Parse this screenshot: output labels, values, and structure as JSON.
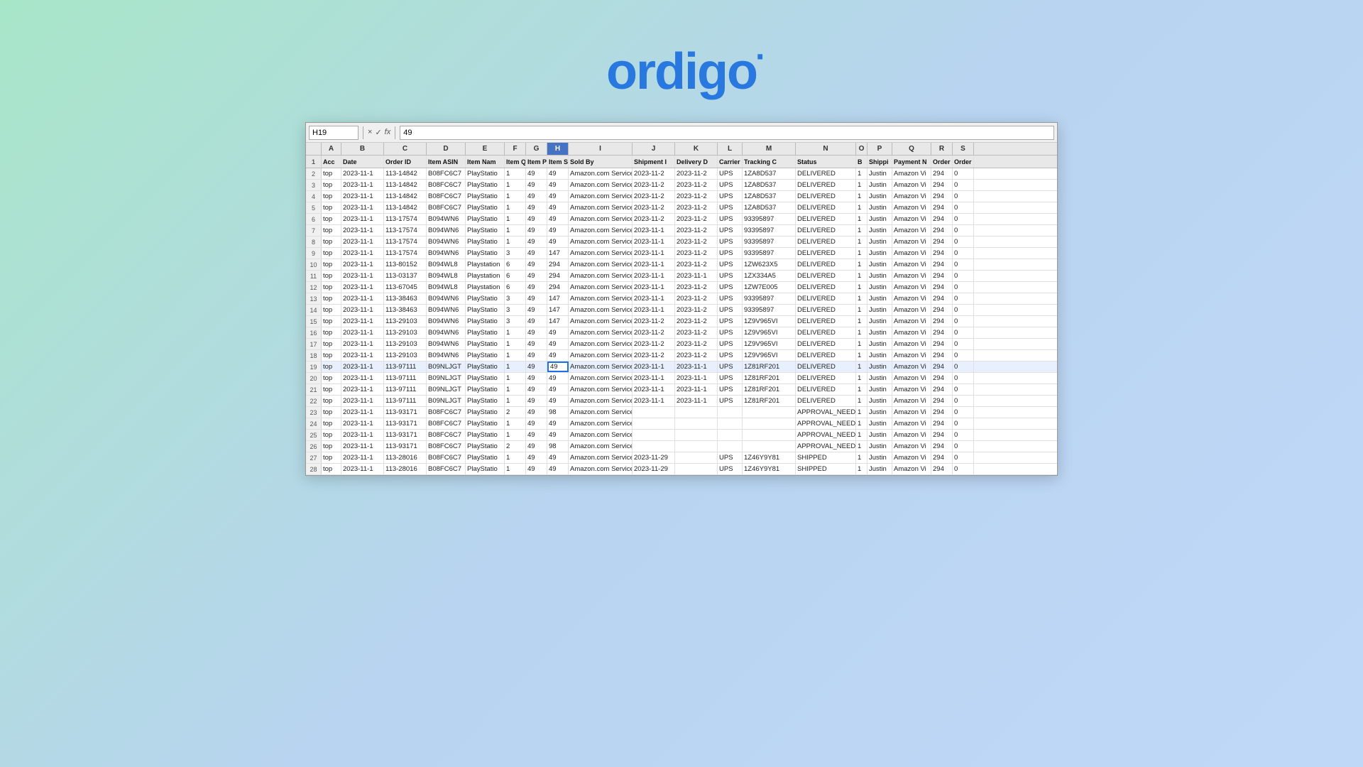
{
  "logo": {
    "text": "ordigo",
    "dot": "·"
  },
  "formula_bar": {
    "cell_ref": "H19",
    "formula_value": "49",
    "icons": [
      "×",
      "✓",
      "fx"
    ]
  },
  "columns": {
    "headers": [
      "A",
      "B",
      "C",
      "D",
      "E",
      "F",
      "G",
      "H",
      "I",
      "J",
      "K",
      "L",
      "M",
      "N",
      "O",
      "P",
      "Q",
      "R",
      "S"
    ]
  },
  "header_labels": {
    "A": "Acc",
    "B": "Date",
    "C": "Order ID",
    "D": "Item ASIN",
    "E": "Item Nam",
    "F": "Item Quan",
    "G": "Item Price",
    "H": "Item Subt",
    "I": "Sold By",
    "J": "Shipment I",
    "K": "Delivery D",
    "L": "Carrier",
    "M": "Tracking C",
    "N": "Status",
    "O": "B",
    "P": "Shippi",
    "Q": "Payment N",
    "R": "Order Subt",
    "S": "Order Ship"
  },
  "rows": [
    {
      "num": 2,
      "a": "top",
      "b": "2023-11-1",
      "c": "113-14842",
      "d": "B08FC6C7",
      "e": "PlayStatio",
      "f": "1",
      "g": "49",
      "h": "49",
      "i": "Amazon.com Services LLC",
      "j": "2023-11-2",
      "k": "2023-11-2",
      "l": "UPS",
      "m": "1ZA8D537",
      "n": "DELIVERED",
      "o": "1",
      "p": "Justin",
      "q": "Amazon Vi",
      "r": "294",
      "s": "0"
    },
    {
      "num": 3,
      "a": "top",
      "b": "2023-11-1",
      "c": "113-14842",
      "d": "B08FC6C7",
      "e": "PlayStatio",
      "f": "1",
      "g": "49",
      "h": "49",
      "i": "Amazon.com Services LLC",
      "j": "2023-11-2",
      "k": "2023-11-2",
      "l": "UPS",
      "m": "1ZA8D537",
      "n": "DELIVERED",
      "o": "1",
      "p": "Justin",
      "q": "Amazon Vi",
      "r": "294",
      "s": "0"
    },
    {
      "num": 4,
      "a": "top",
      "b": "2023-11-1",
      "c": "113-14842",
      "d": "B08FC6C7",
      "e": "PlayStatio",
      "f": "1",
      "g": "49",
      "h": "49",
      "i": "Amazon.com Services LLC",
      "j": "2023-11-2",
      "k": "2023-11-2",
      "l": "UPS",
      "m": "1ZA8D537",
      "n": "DELIVERED",
      "o": "1",
      "p": "Justin",
      "q": "Amazon Vi",
      "r": "294",
      "s": "0"
    },
    {
      "num": 5,
      "a": "top",
      "b": "2023-11-1",
      "c": "113-14842",
      "d": "B08FC6C7",
      "e": "PlayStatio",
      "f": "1",
      "g": "49",
      "h": "49",
      "i": "Amazon.com Services LLC",
      "j": "2023-11-2",
      "k": "2023-11-2",
      "l": "UPS",
      "m": "1ZA8D537",
      "n": "DELIVERED",
      "o": "1",
      "p": "Justin",
      "q": "Amazon Vi",
      "r": "294",
      "s": "0"
    },
    {
      "num": 6,
      "a": "top",
      "b": "2023-11-1",
      "c": "113-17574",
      "d": "B094WN6",
      "e": "PlayStatio",
      "f": "1",
      "g": "49",
      "h": "49",
      "i": "Amazon.com Services LLC",
      "j": "2023-11-2",
      "k": "2023-11-2",
      "l": "UPS",
      "m": "93395897",
      "n": "DELIVERED",
      "o": "1",
      "p": "Justin",
      "q": "Amazon Vi",
      "r": "294",
      "s": "0"
    },
    {
      "num": 7,
      "a": "top",
      "b": "2023-11-1",
      "c": "113-17574",
      "d": "B094WN6",
      "e": "PlayStatio",
      "f": "1",
      "g": "49",
      "h": "49",
      "i": "Amazon.com Services LLC",
      "j": "2023-11-1",
      "k": "2023-11-2",
      "l": "UPS",
      "m": "93395897",
      "n": "DELIVERED",
      "o": "1",
      "p": "Justin",
      "q": "Amazon Vi",
      "r": "294",
      "s": "0"
    },
    {
      "num": 8,
      "a": "top",
      "b": "2023-11-1",
      "c": "113-17574",
      "d": "B094WN6",
      "e": "PlayStatio",
      "f": "1",
      "g": "49",
      "h": "49",
      "i": "Amazon.com Services LLC",
      "j": "2023-11-1",
      "k": "2023-11-2",
      "l": "UPS",
      "m": "93395897",
      "n": "DELIVERED",
      "o": "1",
      "p": "Justin",
      "q": "Amazon Vi",
      "r": "294",
      "s": "0"
    },
    {
      "num": 9,
      "a": "top",
      "b": "2023-11-1",
      "c": "113-17574",
      "d": "B094WN6",
      "e": "PlayStatio",
      "f": "3",
      "g": "49",
      "h": "147",
      "i": "Amazon.com Services LLC",
      "j": "2023-11-1",
      "k": "2023-11-2",
      "l": "UPS",
      "m": "93395897",
      "n": "DELIVERED",
      "o": "1",
      "p": "Justin",
      "q": "Amazon Vi",
      "r": "294",
      "s": "0"
    },
    {
      "num": 10,
      "a": "top",
      "b": "2023-11-1",
      "c": "113-80152",
      "d": "B094WL8",
      "e": "Playstation",
      "f": "6",
      "g": "49",
      "h": "294",
      "i": "Amazon.com Services LLC",
      "j": "2023-11-1",
      "k": "2023-11-2",
      "l": "UPS",
      "m": "1ZW623X5",
      "n": "DELIVERED",
      "o": "1",
      "p": "Justin",
      "q": "Amazon Vi",
      "r": "294",
      "s": "0"
    },
    {
      "num": 11,
      "a": "top",
      "b": "2023-11-1",
      "c": "113-03137",
      "d": "B094WL8",
      "e": "Playstation",
      "f": "6",
      "g": "49",
      "h": "294",
      "i": "Amazon.com Services LLC",
      "j": "2023-11-1",
      "k": "2023-11-1",
      "l": "UPS",
      "m": "1ZX334A5",
      "n": "DELIVERED",
      "o": "1",
      "p": "Justin",
      "q": "Amazon Vi",
      "r": "294",
      "s": "0"
    },
    {
      "num": 12,
      "a": "top",
      "b": "2023-11-1",
      "c": "113-67045",
      "d": "B094WL8",
      "e": "Playstation",
      "f": "6",
      "g": "49",
      "h": "294",
      "i": "Amazon.com Services LLC",
      "j": "2023-11-1",
      "k": "2023-11-2",
      "l": "UPS",
      "m": "1ZW7E005",
      "n": "DELIVERED",
      "o": "1",
      "p": "Justin",
      "q": "Amazon Vi",
      "r": "294",
      "s": "0"
    },
    {
      "num": 13,
      "a": "top",
      "b": "2023-11-1",
      "c": "113-38463",
      "d": "B094WN6",
      "e": "PlayStatio",
      "f": "3",
      "g": "49",
      "h": "147",
      "i": "Amazon.com Services LLC",
      "j": "2023-11-1",
      "k": "2023-11-2",
      "l": "UPS",
      "m": "93395897",
      "n": "DELIVERED",
      "o": "1",
      "p": "Justin",
      "q": "Amazon Vi",
      "r": "294",
      "s": "0"
    },
    {
      "num": 14,
      "a": "top",
      "b": "2023-11-1",
      "c": "113-38463",
      "d": "B094WN6",
      "e": "PlayStatio",
      "f": "3",
      "g": "49",
      "h": "147",
      "i": "Amazon.com Services LLC",
      "j": "2023-11-1",
      "k": "2023-11-2",
      "l": "UPS",
      "m": "93395897",
      "n": "DELIVERED",
      "o": "1",
      "p": "Justin",
      "q": "Amazon Vi",
      "r": "294",
      "s": "0"
    },
    {
      "num": 15,
      "a": "top",
      "b": "2023-11-1",
      "c": "113-29103",
      "d": "B094WN6",
      "e": "PlayStatio",
      "f": "3",
      "g": "49",
      "h": "147",
      "i": "Amazon.com Services LLC",
      "j": "2023-11-2",
      "k": "2023-11-2",
      "l": "UPS",
      "m": "1Z9V965VI",
      "n": "DELIVERED",
      "o": "1",
      "p": "Justin",
      "q": "Amazon Vi",
      "r": "294",
      "s": "0"
    },
    {
      "num": 16,
      "a": "top",
      "b": "2023-11-1",
      "c": "113-29103",
      "d": "B094WN6",
      "e": "PlayStatio",
      "f": "1",
      "g": "49",
      "h": "49",
      "i": "Amazon.com Services LLC",
      "j": "2023-11-2",
      "k": "2023-11-2",
      "l": "UPS",
      "m": "1Z9V965VI",
      "n": "DELIVERED",
      "o": "1",
      "p": "Justin",
      "q": "Amazon Vi",
      "r": "294",
      "s": "0"
    },
    {
      "num": 17,
      "a": "top",
      "b": "2023-11-1",
      "c": "113-29103",
      "d": "B094WN6",
      "e": "PlayStatio",
      "f": "1",
      "g": "49",
      "h": "49",
      "i": "Amazon.com Services LLC",
      "j": "2023-11-2",
      "k": "2023-11-2",
      "l": "UPS",
      "m": "1Z9V965VI",
      "n": "DELIVERED",
      "o": "1",
      "p": "Justin",
      "q": "Amazon Vi",
      "r": "294",
      "s": "0"
    },
    {
      "num": 18,
      "a": "top",
      "b": "2023-11-1",
      "c": "113-29103",
      "d": "B094WN6",
      "e": "PlayStatio",
      "f": "1",
      "g": "49",
      "h": "49",
      "i": "Amazon.com Services LLC",
      "j": "2023-11-2",
      "k": "2023-11-2",
      "l": "UPS",
      "m": "1Z9V965VI",
      "n": "DELIVERED",
      "o": "1",
      "p": "Justin",
      "q": "Amazon Vi",
      "r": "294",
      "s": "0"
    },
    {
      "num": 19,
      "a": "top",
      "b": "2023-11-1",
      "c": "113-97111",
      "d": "B09NLJGT",
      "e": "PlayStatio",
      "f": "1",
      "g": "49",
      "h": "49",
      "i": "Amazon.com Services LLC",
      "j": "2023-11-1",
      "k": "2023-11-1",
      "l": "UPS",
      "m": "1Z81RF201",
      "n": "DELIVERED",
      "o": "1",
      "p": "Justin",
      "q": "Amazon Vi",
      "r": "294",
      "s": "0",
      "selected": true
    },
    {
      "num": 20,
      "a": "top",
      "b": "2023-11-1",
      "c": "113-97111",
      "d": "B09NLJGT",
      "e": "PlayStatio",
      "f": "1",
      "g": "49",
      "h": "49",
      "i": "Amazon.com Services LLC",
      "j": "2023-11-1",
      "k": "2023-11-1",
      "l": "UPS",
      "m": "1Z81RF201",
      "n": "DELIVERED",
      "o": "1",
      "p": "Justin",
      "q": "Amazon Vi",
      "r": "294",
      "s": "0"
    },
    {
      "num": 21,
      "a": "top",
      "b": "2023-11-1",
      "c": "113-97111",
      "d": "B09NLJGT",
      "e": "PlayStatio",
      "f": "1",
      "g": "49",
      "h": "49",
      "i": "Amazon.com Services LLC",
      "j": "2023-11-1",
      "k": "2023-11-1",
      "l": "UPS",
      "m": "1Z81RF201",
      "n": "DELIVERED",
      "o": "1",
      "p": "Justin",
      "q": "Amazon Vi",
      "r": "294",
      "s": "0"
    },
    {
      "num": 22,
      "a": "top",
      "b": "2023-11-1",
      "c": "113-97111",
      "d": "B09NLJGT",
      "e": "PlayStatio",
      "f": "1",
      "g": "49",
      "h": "49",
      "i": "Amazon.com Services LLC",
      "j": "2023-11-1",
      "k": "2023-11-1",
      "l": "UPS",
      "m": "1Z81RF201",
      "n": "DELIVERED",
      "o": "1",
      "p": "Justin",
      "q": "Amazon Vi",
      "r": "294",
      "s": "0"
    },
    {
      "num": 23,
      "a": "top",
      "b": "2023-11-1",
      "c": "113-93171",
      "d": "B08FC6C7",
      "e": "PlayStatio",
      "f": "2",
      "g": "49",
      "h": "98",
      "i": "Amazon.com Services LLC",
      "j": "",
      "k": "",
      "l": "",
      "m": "",
      "n": "APPROVAL_NEEDED",
      "o": "1",
      "p": "Justin",
      "q": "Amazon Vi",
      "r": "294",
      "s": "0"
    },
    {
      "num": 24,
      "a": "top",
      "b": "2023-11-1",
      "c": "113-93171",
      "d": "B08FC6C7",
      "e": "PlayStatio",
      "f": "1",
      "g": "49",
      "h": "49",
      "i": "Amazon.com Services LLC",
      "j": "",
      "k": "",
      "l": "",
      "m": "",
      "n": "APPROVAL_NEEDED",
      "o": "1",
      "p": "Justin",
      "q": "Amazon Vi",
      "r": "294",
      "s": "0"
    },
    {
      "num": 25,
      "a": "top",
      "b": "2023-11-1",
      "c": "113-93171",
      "d": "B08FC6C7",
      "e": "PlayStatio",
      "f": "1",
      "g": "49",
      "h": "49",
      "i": "Amazon.com Services LLC",
      "j": "",
      "k": "",
      "l": "",
      "m": "",
      "n": "APPROVAL_NEEDED",
      "o": "1",
      "p": "Justin",
      "q": "Amazon Vi",
      "r": "294",
      "s": "0"
    },
    {
      "num": 26,
      "a": "top",
      "b": "2023-11-1",
      "c": "113-93171",
      "d": "B08FC6C7",
      "e": "PlayStatio",
      "f": "2",
      "g": "49",
      "h": "98",
      "i": "Amazon.com Services LLC",
      "j": "",
      "k": "",
      "l": "",
      "m": "",
      "n": "APPROVAL_NEEDED",
      "o": "1",
      "p": "Justin",
      "q": "Amazon Vi",
      "r": "294",
      "s": "0"
    },
    {
      "num": 27,
      "a": "top",
      "b": "2023-11-1",
      "c": "113-28016",
      "d": "B08FC6C7",
      "e": "PlayStatio",
      "f": "1",
      "g": "49",
      "h": "49",
      "i": "Amazon.com Services LLC",
      "j": "2023-11-29",
      "k": "",
      "l": "UPS",
      "m": "1Z46Y9Y81",
      "n": "SHIPPED",
      "o": "1",
      "p": "Justin",
      "q": "Amazon Vi",
      "r": "294",
      "s": "0"
    },
    {
      "num": 28,
      "a": "top",
      "b": "2023-11-1",
      "c": "113-28016",
      "d": "B08FC6C7",
      "e": "PlayStatio",
      "f": "1",
      "g": "49",
      "h": "49",
      "i": "Amazon.com Services LLC",
      "j": "2023-11-29",
      "k": "",
      "l": "UPS",
      "m": "1Z46Y9Y81",
      "n": "SHIPPED",
      "o": "1",
      "p": "Justin",
      "q": "Amazon Vi",
      "r": "294",
      "s": "0"
    }
  ]
}
